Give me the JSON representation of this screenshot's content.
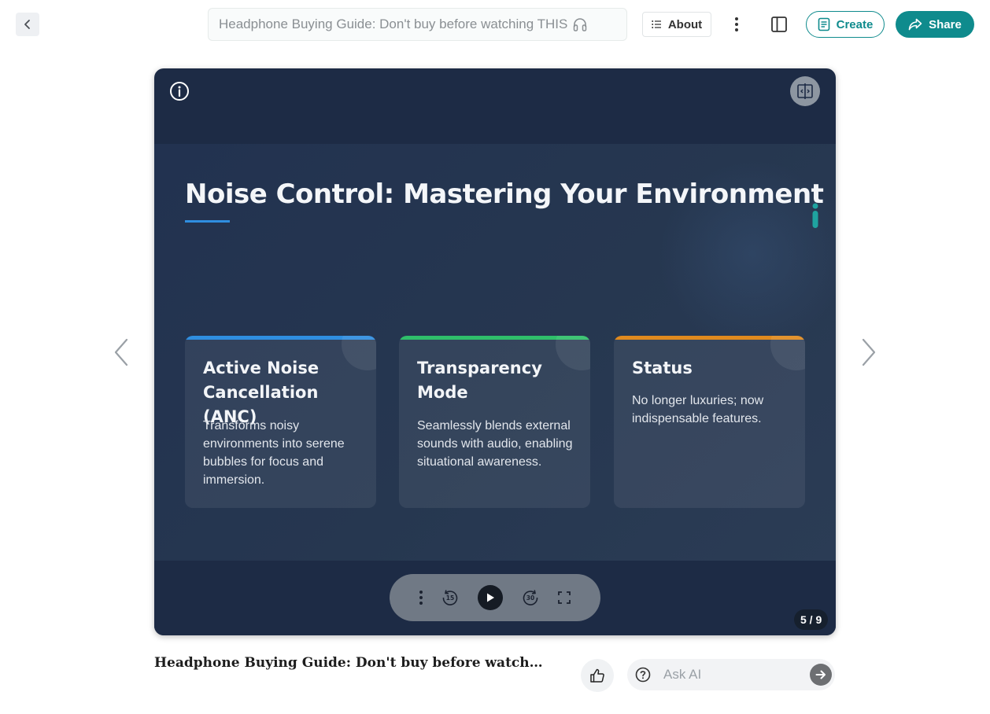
{
  "header": {
    "title": "Headphone Buying Guide: Don't buy before watching THIS",
    "about_label": "About",
    "create_label": "Create",
    "share_label": "Share",
    "accent_color": "#0f8b8d"
  },
  "slide": {
    "title": "Noise Control: Mastering Your Environment",
    "cards": [
      {
        "title": "Active Noise Cancellation (ANC)",
        "body": "Transforms noisy environments into serene bubbles for focus and immersion.",
        "accent_color": "#2f8ee0"
      },
      {
        "title": "Transparency Mode",
        "body": "Seamlessly blends external sounds with audio, enabling situational awareness.",
        "accent_color": "#2fbf6a"
      },
      {
        "title": "Status",
        "body": "No longer luxuries; now indispensable features.",
        "accent_color": "#e08a1e"
      }
    ]
  },
  "player": {
    "page_counter": "5 / 9",
    "rewind_seconds": "15",
    "forward_seconds": "30",
    "icons": [
      "info-icon",
      "compare-icon",
      "more-vertical-icon",
      "rewind-icon",
      "play-icon",
      "forward-icon",
      "fullscreen-icon"
    ]
  },
  "footer": {
    "title": "Headphone Buying Guide: Don't buy before watching THIS",
    "ask_placeholder": "Ask AI"
  }
}
